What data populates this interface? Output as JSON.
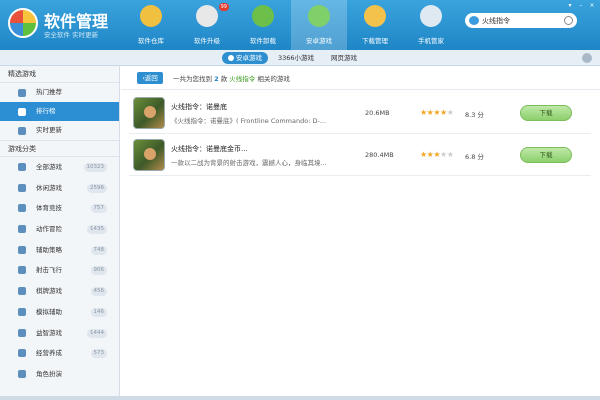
{
  "app": {
    "title": "软件管理",
    "subtitle": "安全软件 实时更新"
  },
  "nav": [
    {
      "label": "软件仓库",
      "icon": "disc-icon",
      "color": "#f0c040"
    },
    {
      "label": "软件升级",
      "icon": "upgrade-disc-icon",
      "color": "#e8e8e8",
      "badge": "99"
    },
    {
      "label": "软件卸载",
      "icon": "recycle-bin-icon",
      "color": "#6cc04a"
    },
    {
      "label": "安卓游戏",
      "icon": "android-bag-icon",
      "color": "#7fd06a",
      "active": true
    },
    {
      "label": "下载管理",
      "icon": "download-folder-icon",
      "color": "#f3c24a"
    },
    {
      "label": "手机管家",
      "icon": "shield-icon",
      "color": "#dfe9f2"
    }
  ],
  "search": {
    "value": "火线指令"
  },
  "subtabs": [
    {
      "label": "安卓游戏",
      "active": true
    },
    {
      "label": "3366小游戏"
    },
    {
      "label": "网页游戏"
    }
  ],
  "sidebar": {
    "featured_title": "精选游戏",
    "featured": [
      {
        "label": "热门推荐",
        "icon": "drop-icon"
      },
      {
        "label": "排行榜",
        "icon": "trophy-icon",
        "active": true
      },
      {
        "label": "实时更新",
        "icon": "clock-icon"
      }
    ],
    "category_title": "游戏分类",
    "categories": [
      {
        "label": "全部游戏",
        "count": "10323",
        "icon": "grid-icon"
      },
      {
        "label": "休闲游戏",
        "count": "2596",
        "icon": "cup-icon"
      },
      {
        "label": "体育竞技",
        "count": "757",
        "icon": "ball-icon"
      },
      {
        "label": "动作冒险",
        "count": "1435",
        "icon": "sword-icon"
      },
      {
        "label": "辅助策略",
        "count": "748",
        "icon": "tower-icon"
      },
      {
        "label": "射击飞行",
        "count": "906",
        "icon": "plane-icon"
      },
      {
        "label": "棋牌游戏",
        "count": "456",
        "icon": "chess-icon"
      },
      {
        "label": "模拟辅助",
        "count": "146",
        "icon": "wrench-icon"
      },
      {
        "label": "益智游戏",
        "count": "1444",
        "icon": "bulb-icon"
      },
      {
        "label": "经营养成",
        "count": "573",
        "icon": "building-icon"
      },
      {
        "label": "角色扮演",
        "count": "",
        "icon": "mask-icon"
      }
    ]
  },
  "results": {
    "back_label": "返回",
    "prefix": "一共为您找到",
    "count": "2",
    "mid": "款",
    "keyword": "火线指令",
    "suffix": "相关的游戏"
  },
  "games": [
    {
      "name": "火线指令：诺曼底",
      "desc": "《火线指令：诺曼底》( Frontline Commando: D-...",
      "size": "20.6MB",
      "rating": 4,
      "score": "8.3 分",
      "download_label": "下载"
    },
    {
      "name": "火线指令：诺曼底金币...",
      "desc": "一款以二战为背景的射击游戏，震撼人心，身临其境...",
      "size": "280.4MB",
      "rating": 3,
      "score": "6.8 分",
      "download_label": "下载"
    }
  ],
  "colors": {
    "header": "#2a93d3",
    "accent": "#2e8fd0",
    "download": "#8ccf6c",
    "star": "#f2a623"
  }
}
